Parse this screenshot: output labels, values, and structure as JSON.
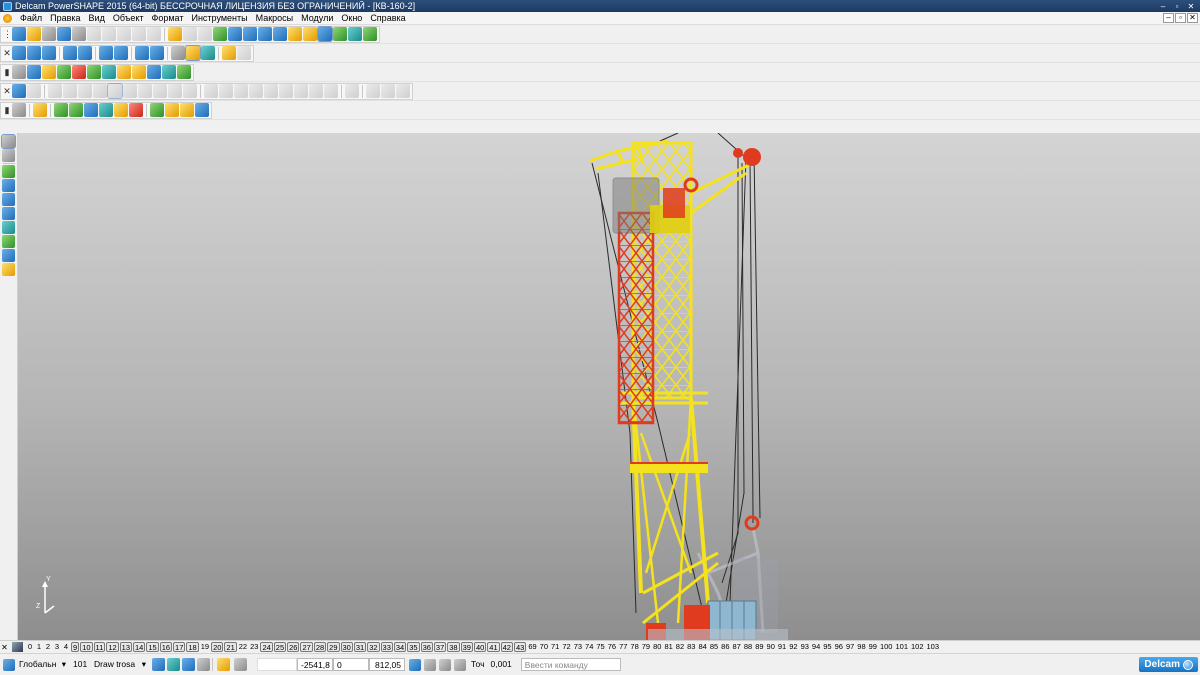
{
  "window": {
    "title": "Delcam PowerSHAPE 2015 (64-bit) БЕССРОЧНАЯ ЛИЦЕНЗИЯ БЕЗ ОГРАНИЧЕНИЙ - [КВ-160-2]",
    "controls": {
      "minimize": "–",
      "restore": "▫",
      "close": "✕"
    }
  },
  "menu": {
    "items": [
      "Файл",
      "Правка",
      "Вид",
      "Объект",
      "Формат",
      "Инструменты",
      "Макросы",
      "Модули",
      "Окно",
      "Справка"
    ],
    "mdi_controls": {
      "minimize": "–",
      "restore": "▫",
      "close": "✕"
    }
  },
  "viewport": {
    "axis_y_label": "Y",
    "axis_z_label": "Z",
    "colors": {
      "yellow": "#f3e21d",
      "red": "#e03b1e",
      "cable": "#2a2a2a",
      "panel": "#8fb7cf",
      "frame": "#c8ccd8"
    }
  },
  "layers": {
    "items": [
      {
        "n": "0",
        "boxed": false
      },
      {
        "n": "1",
        "boxed": false
      },
      {
        "n": "2",
        "boxed": false
      },
      {
        "n": "3",
        "boxed": false
      },
      {
        "n": "4",
        "boxed": false
      },
      {
        "n": "9",
        "boxed": true
      },
      {
        "n": "10",
        "boxed": true
      },
      {
        "n": "11",
        "boxed": true
      },
      {
        "n": "12",
        "boxed": true
      },
      {
        "n": "13",
        "boxed": true
      },
      {
        "n": "14",
        "boxed": true
      },
      {
        "n": "15",
        "boxed": true
      },
      {
        "n": "16",
        "boxed": true
      },
      {
        "n": "17",
        "boxed": true
      },
      {
        "n": "18",
        "boxed": true
      },
      {
        "n": "19",
        "boxed": false
      },
      {
        "n": "20",
        "boxed": true
      },
      {
        "n": "21",
        "boxed": true
      },
      {
        "n": "22",
        "boxed": false
      },
      {
        "n": "23",
        "boxed": false
      },
      {
        "n": "24",
        "boxed": true
      },
      {
        "n": "25",
        "boxed": true
      },
      {
        "n": "26",
        "boxed": true
      },
      {
        "n": "27",
        "boxed": true
      },
      {
        "n": "28",
        "boxed": true
      },
      {
        "n": "29",
        "boxed": true
      },
      {
        "n": "30",
        "boxed": true
      },
      {
        "n": "31",
        "boxed": true
      },
      {
        "n": "32",
        "boxed": true
      },
      {
        "n": "33",
        "boxed": true
      },
      {
        "n": "34",
        "boxed": true
      },
      {
        "n": "35",
        "boxed": true
      },
      {
        "n": "36",
        "boxed": true
      },
      {
        "n": "37",
        "boxed": true
      },
      {
        "n": "38",
        "boxed": true
      },
      {
        "n": "39",
        "boxed": true
      },
      {
        "n": "40",
        "boxed": true
      },
      {
        "n": "41",
        "boxed": true
      },
      {
        "n": "42",
        "boxed": true
      },
      {
        "n": "43",
        "boxed": true
      },
      {
        "n": "69",
        "boxed": false
      },
      {
        "n": "70",
        "boxed": false
      },
      {
        "n": "71",
        "boxed": false
      },
      {
        "n": "72",
        "boxed": false
      },
      {
        "n": "73",
        "boxed": false
      },
      {
        "n": "74",
        "boxed": false
      },
      {
        "n": "75",
        "boxed": false
      },
      {
        "n": "76",
        "boxed": false
      },
      {
        "n": "77",
        "boxed": false
      },
      {
        "n": "78",
        "boxed": false
      },
      {
        "n": "79",
        "boxed": false
      },
      {
        "n": "80",
        "boxed": false
      },
      {
        "n": "81",
        "boxed": false
      },
      {
        "n": "82",
        "boxed": false
      },
      {
        "n": "83",
        "boxed": false
      },
      {
        "n": "84",
        "boxed": false
      },
      {
        "n": "85",
        "boxed": false
      },
      {
        "n": "86",
        "boxed": false
      },
      {
        "n": "87",
        "boxed": false
      },
      {
        "n": "88",
        "boxed": false
      },
      {
        "n": "89",
        "boxed": false
      },
      {
        "n": "90",
        "boxed": false
      },
      {
        "n": "91",
        "boxed": false
      },
      {
        "n": "92",
        "boxed": false
      },
      {
        "n": "93",
        "boxed": false
      },
      {
        "n": "94",
        "boxed": false
      },
      {
        "n": "95",
        "boxed": false
      },
      {
        "n": "96",
        "boxed": false
      },
      {
        "n": "97",
        "boxed": false
      },
      {
        "n": "98",
        "boxed": false
      },
      {
        "n": "99",
        "boxed": false
      },
      {
        "n": "100",
        "boxed": false
      },
      {
        "n": "101",
        "boxed": false
      },
      {
        "n": "102",
        "boxed": false
      },
      {
        "n": "103",
        "boxed": false
      }
    ]
  },
  "status": {
    "workplane": "Глобальн",
    "level_number": "101",
    "level_name": "Draw trosa",
    "x": "-2541,8",
    "y": "0",
    "z": "812,05",
    "tolerance_label": "Точ",
    "tolerance_value": "0,001",
    "command_placeholder": "Ввести команду",
    "brand": "Delcam"
  }
}
